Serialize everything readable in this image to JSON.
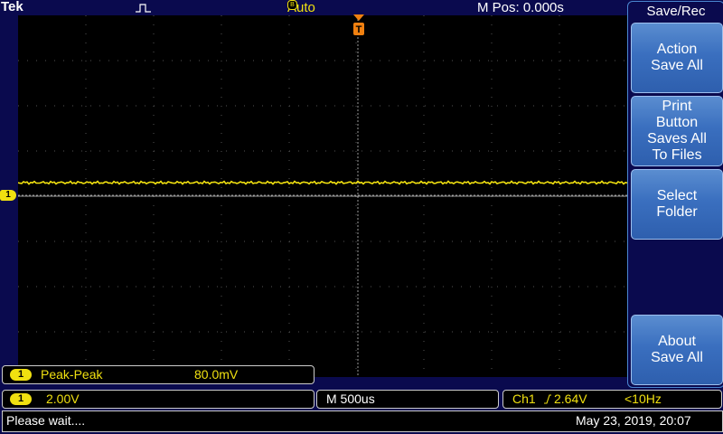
{
  "topbar": {
    "brand": "Tek",
    "acq_mode": "Auto",
    "acq_mode_box": "B",
    "horizontal_position": "M Pos: 0.000s"
  },
  "side_menu": {
    "title": "Save/Rec",
    "buttons": [
      {
        "line1": "Action",
        "line2": "Save All"
      },
      {
        "line1": "Print",
        "line2": "Button",
        "line3": "Saves All",
        "line4": "To Files"
      },
      {
        "line1": "Select",
        "line2": "Folder"
      },
      {
        "line1": "About",
        "line2": "Save All"
      }
    ]
  },
  "channel_marker": "1",
  "trigger_marker": "T",
  "measurement": {
    "channel": "1",
    "name": "Peak-Peak",
    "value": "80.0mV"
  },
  "vertical": {
    "channel": "1",
    "scale": "2.00V"
  },
  "timebase": "M 500us",
  "trigger": {
    "source": "Ch1",
    "slope_icon": "rising-edge-icon",
    "level": "2.64V",
    "frequency": "<10Hz"
  },
  "status": {
    "message": "Please wait....",
    "datetime": "May 23, 2019, 20:07"
  },
  "colors": {
    "background": "#0a0a4e",
    "channel1": "#f0e010",
    "softkey": "#3a6fbf",
    "trigger": "#f08010"
  }
}
